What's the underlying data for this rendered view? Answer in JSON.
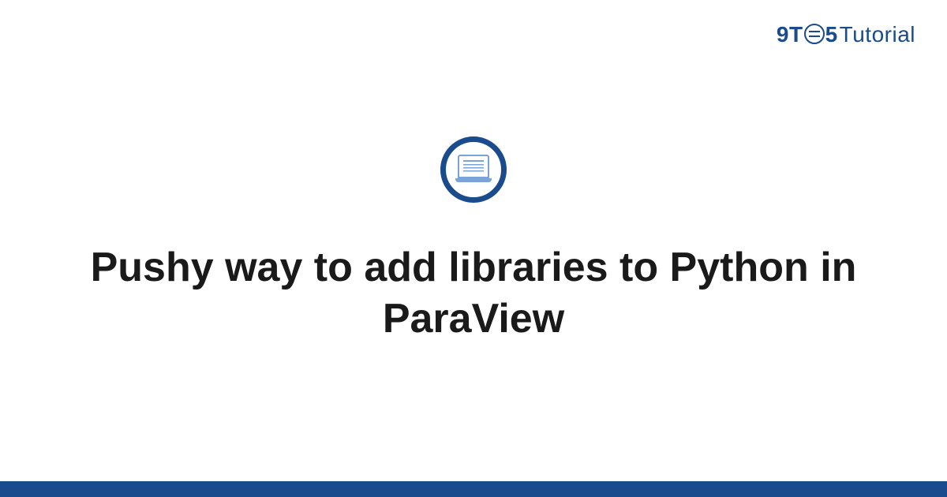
{
  "logo": {
    "part1": "9T",
    "part2": "5",
    "part3": "Tutorial"
  },
  "title": "Pushy way to add libraries to Python in ParaView",
  "colors": {
    "brand": "#1a4b8c",
    "icon_accent": "#7aa3d9"
  }
}
